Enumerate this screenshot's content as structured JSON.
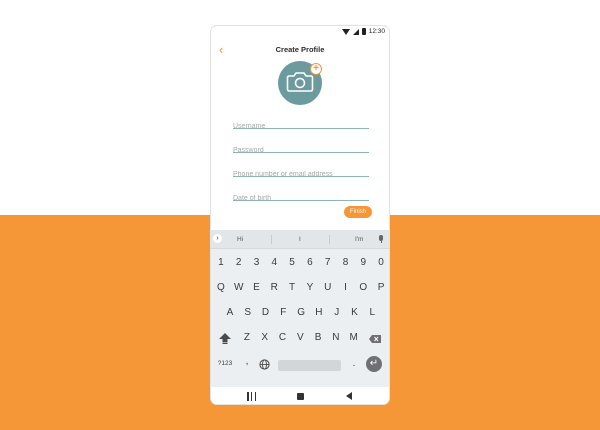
{
  "status_bar": {
    "time": "12:30",
    "icons": [
      "wifi-icon",
      "signal-icon",
      "battery-icon"
    ]
  },
  "header": {
    "back_icon": "chevron-left-icon",
    "back_glyph": "‹",
    "title": "Create Profile"
  },
  "avatar": {
    "icon": "camera-icon",
    "badge_icon": "plus-icon",
    "badge_glyph": "+"
  },
  "form": {
    "username": {
      "value": "",
      "placeholder": "Username"
    },
    "password": {
      "value": "",
      "placeholder": "Password"
    },
    "contact": {
      "value": "",
      "placeholder": "Phone number or email address"
    },
    "dob": {
      "value": "",
      "placeholder": "Date of birth"
    },
    "finish_label": "Finish"
  },
  "keyboard": {
    "suggestions": [
      "Hi",
      "I",
      "I'm"
    ],
    "expand_glyph": "›",
    "number_row": [
      "1",
      "2",
      "3",
      "4",
      "5",
      "6",
      "7",
      "8",
      "9",
      "0"
    ],
    "row1": [
      "Q",
      "W",
      "E",
      "R",
      "T",
      "Y",
      "U",
      "I",
      "O",
      "P"
    ],
    "row2": [
      "A",
      "S",
      "D",
      "F",
      "G",
      "H",
      "J",
      "K",
      "L"
    ],
    "row3": [
      "Z",
      "X",
      "C",
      "V",
      "B",
      "N",
      "M"
    ],
    "symbols_label": "?123",
    "comma_label": ",",
    "period_label": ".",
    "enter_glyph": "↵"
  },
  "colors": {
    "accent": "#f59637",
    "avatar": "#6b9b9e",
    "field_line": "#8fb3b5"
  }
}
